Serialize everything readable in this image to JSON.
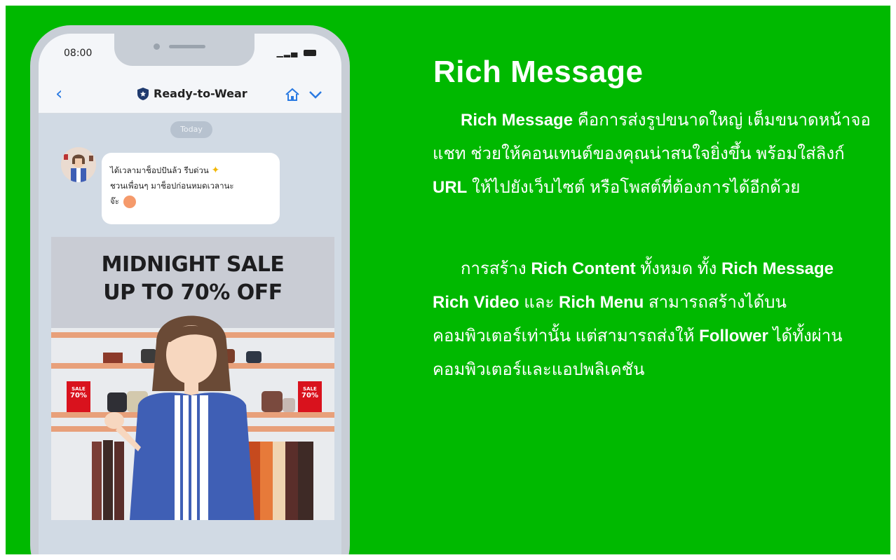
{
  "colors": {
    "brand_green": "#00b900",
    "phone_frame": "#c8ced6",
    "chat_background": "#d1dae4",
    "header_accent": "#2a7ae2"
  },
  "phone": {
    "status_time": "08:00",
    "chat_title": "Ready-to-Wear",
    "date_pill": "Today",
    "message_line1": "ได้เวลามาช็อปปันล้ว รีบด่วน",
    "message_line2": "ชวนเพื่อนๆ มาช็อปก่อนหมดเวลานะ",
    "message_line3": "จ๊ะ",
    "promo": {
      "line1": "MIDNIGHT SALE",
      "line2": "UP TO 70% OFF",
      "tag_top": "SALE",
      "tag_bottom": "70%"
    },
    "icons": [
      "back-chevron-icon",
      "shield-icon",
      "home-icon",
      "chevron-down-icon",
      "sparkle-icon",
      "smile-emoji-icon"
    ]
  },
  "content": {
    "heading": "Rich Message",
    "p1": {
      "b1": "Rich Message",
      "t1": " คือการส่งรูปขนาดใหญ่ เต็มขนาดหน้าจอแชท ช่วยให้คอนเทนต์ของคุณน่าสนใจยิ่งขึ้น พร้อมใส่ลิงก์ ",
      "b2": "URL",
      "t2": " ให้ไปยังเว็บไซต์ หรือโพสต์ที่ต้องการได้อีกด้วย"
    },
    "p2": {
      "t1": "การสร้าง ",
      "b1": "Rich Content",
      "t2": " ทั้งหมด ทั้ง ",
      "b2": "Rich Message",
      "t3": " ",
      "b3": "Rich Video",
      "t4": " และ ",
      "b4": "Rich Menu",
      "t5": " สามารถสร้างได้บนคอมพิวเตอร์เท่านั้น แต่สามารถส่งให้ ",
      "b5": "Follower",
      "t6": " ได้ทั้งผ่านคอมพิวเตอร์และแอปพลิเคชัน"
    }
  }
}
